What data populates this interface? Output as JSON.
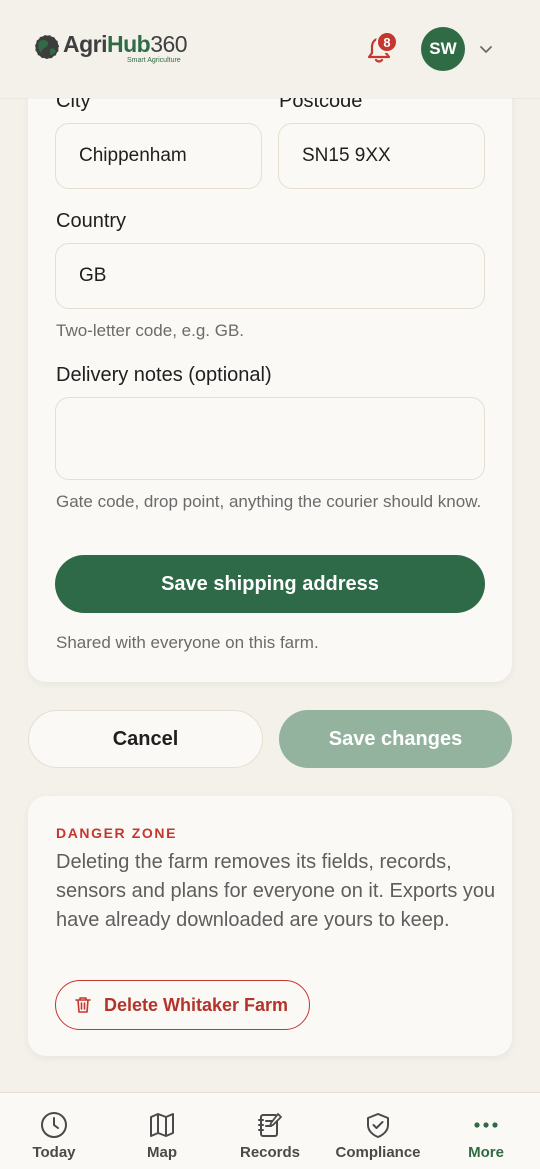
{
  "header": {
    "logo_name_part1": "Agri",
    "logo_name_part2": "Hub",
    "logo_name_part3": "360",
    "logo_tagline": "Smart Agriculture",
    "notification_count": "8",
    "avatar_initials": "SW",
    "icons": [
      "globe-icon",
      "bell-icon",
      "chevron-down-icon"
    ]
  },
  "form": {
    "city_label": "City",
    "city_value": "Chippenham",
    "postcode_label": "Postcode",
    "postcode_value": "SN15 9XX",
    "country_label": "Country",
    "country_value": "GB",
    "country_hint": "Two-letter code, e.g. GB.",
    "notes_label": "Delivery notes (optional)",
    "notes_value": "",
    "notes_hint": "Gate code, drop point, anything the courier should know.",
    "save_shipping_label": "Save shipping address",
    "shared_note": "Shared with everyone on this farm."
  },
  "actions": {
    "cancel_label": "Cancel",
    "save_changes_label": "Save changes"
  },
  "danger_zone": {
    "title": "DANGER ZONE",
    "text": "Deleting the farm removes its fields, records, sensors and plans for everyone on it. Exports you have already downloaded are yours to keep.",
    "delete_label": "Delete Whitaker Farm"
  },
  "nav": {
    "items": [
      {
        "label": "Today",
        "icon": "clock-icon"
      },
      {
        "label": "Map",
        "icon": "map-icon"
      },
      {
        "label": "Records",
        "icon": "notebook-icon"
      },
      {
        "label": "Compliance",
        "icon": "shield-check-icon"
      },
      {
        "label": "More",
        "icon": "more-dots-icon"
      }
    ],
    "active": "More"
  },
  "colors": {
    "brand_green": "#2e6a47",
    "disabled_green": "#93b39f",
    "danger_red": "#c4362e",
    "background": "#f4f1ea"
  }
}
